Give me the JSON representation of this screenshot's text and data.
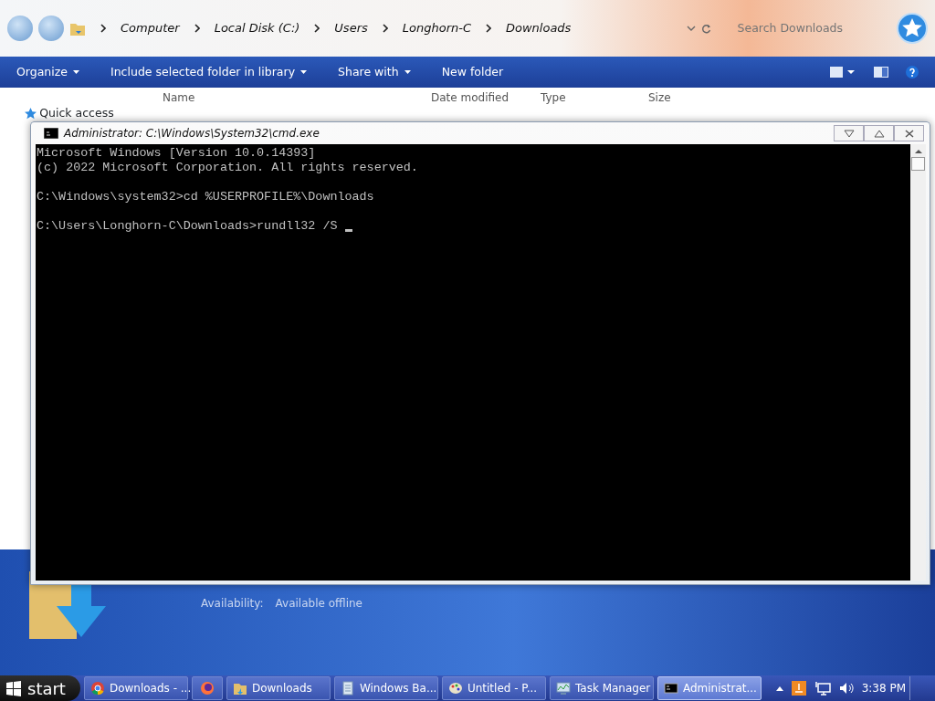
{
  "explorer": {
    "address": [
      "Computer",
      "Local Disk (C:)",
      "Users",
      "Longhorn-C",
      "Downloads"
    ],
    "search": {
      "placeholder": "Search Downloads"
    },
    "toolbar": [
      {
        "label": "Organize",
        "menu": true
      },
      {
        "label": "Include selected folder in library",
        "menu": true
      },
      {
        "label": "Share with",
        "menu": true
      },
      {
        "label": "New folder",
        "menu": false
      }
    ],
    "columns": [
      "Name",
      "Date modified",
      "Type",
      "Size"
    ],
    "nav": [
      {
        "label": "Quick access"
      }
    ],
    "details": {
      "label": "Availability:",
      "value": "Available offline"
    }
  },
  "console": {
    "title": "Administrator: C:\\Windows\\System32\\cmd.exe",
    "blocks": [
      [
        "Microsoft Windows [Version 10.0.14393]",
        "(c) 2022 Microsoft Corporation. All rights reserved."
      ],
      [
        "C:\\Windows\\system32>cd %USERPROFILE%\\Downloads"
      ],
      [
        "C:\\Users\\Longhorn-C\\Downloads>rundll32 /S "
      ]
    ],
    "cursor": true
  },
  "taskbar": {
    "start": "start",
    "buttons": [
      {
        "kind": "chrome",
        "label": "Downloads - ...",
        "selected": false
      },
      {
        "kind": "firefox",
        "selected": false
      },
      {
        "kind": "folder",
        "label": "Downloads",
        "selected": false
      },
      {
        "kind": "notepad",
        "label": "Windows Ba...",
        "selected": false
      },
      {
        "kind": "paint",
        "label": "Untitled - P...",
        "selected": false
      },
      {
        "kind": "taskmgr",
        "label": "Task Manager",
        "selected": false
      },
      {
        "kind": "cmd",
        "label": "Administrat...",
        "selected": true
      }
    ],
    "clock": "3:38 PM"
  }
}
